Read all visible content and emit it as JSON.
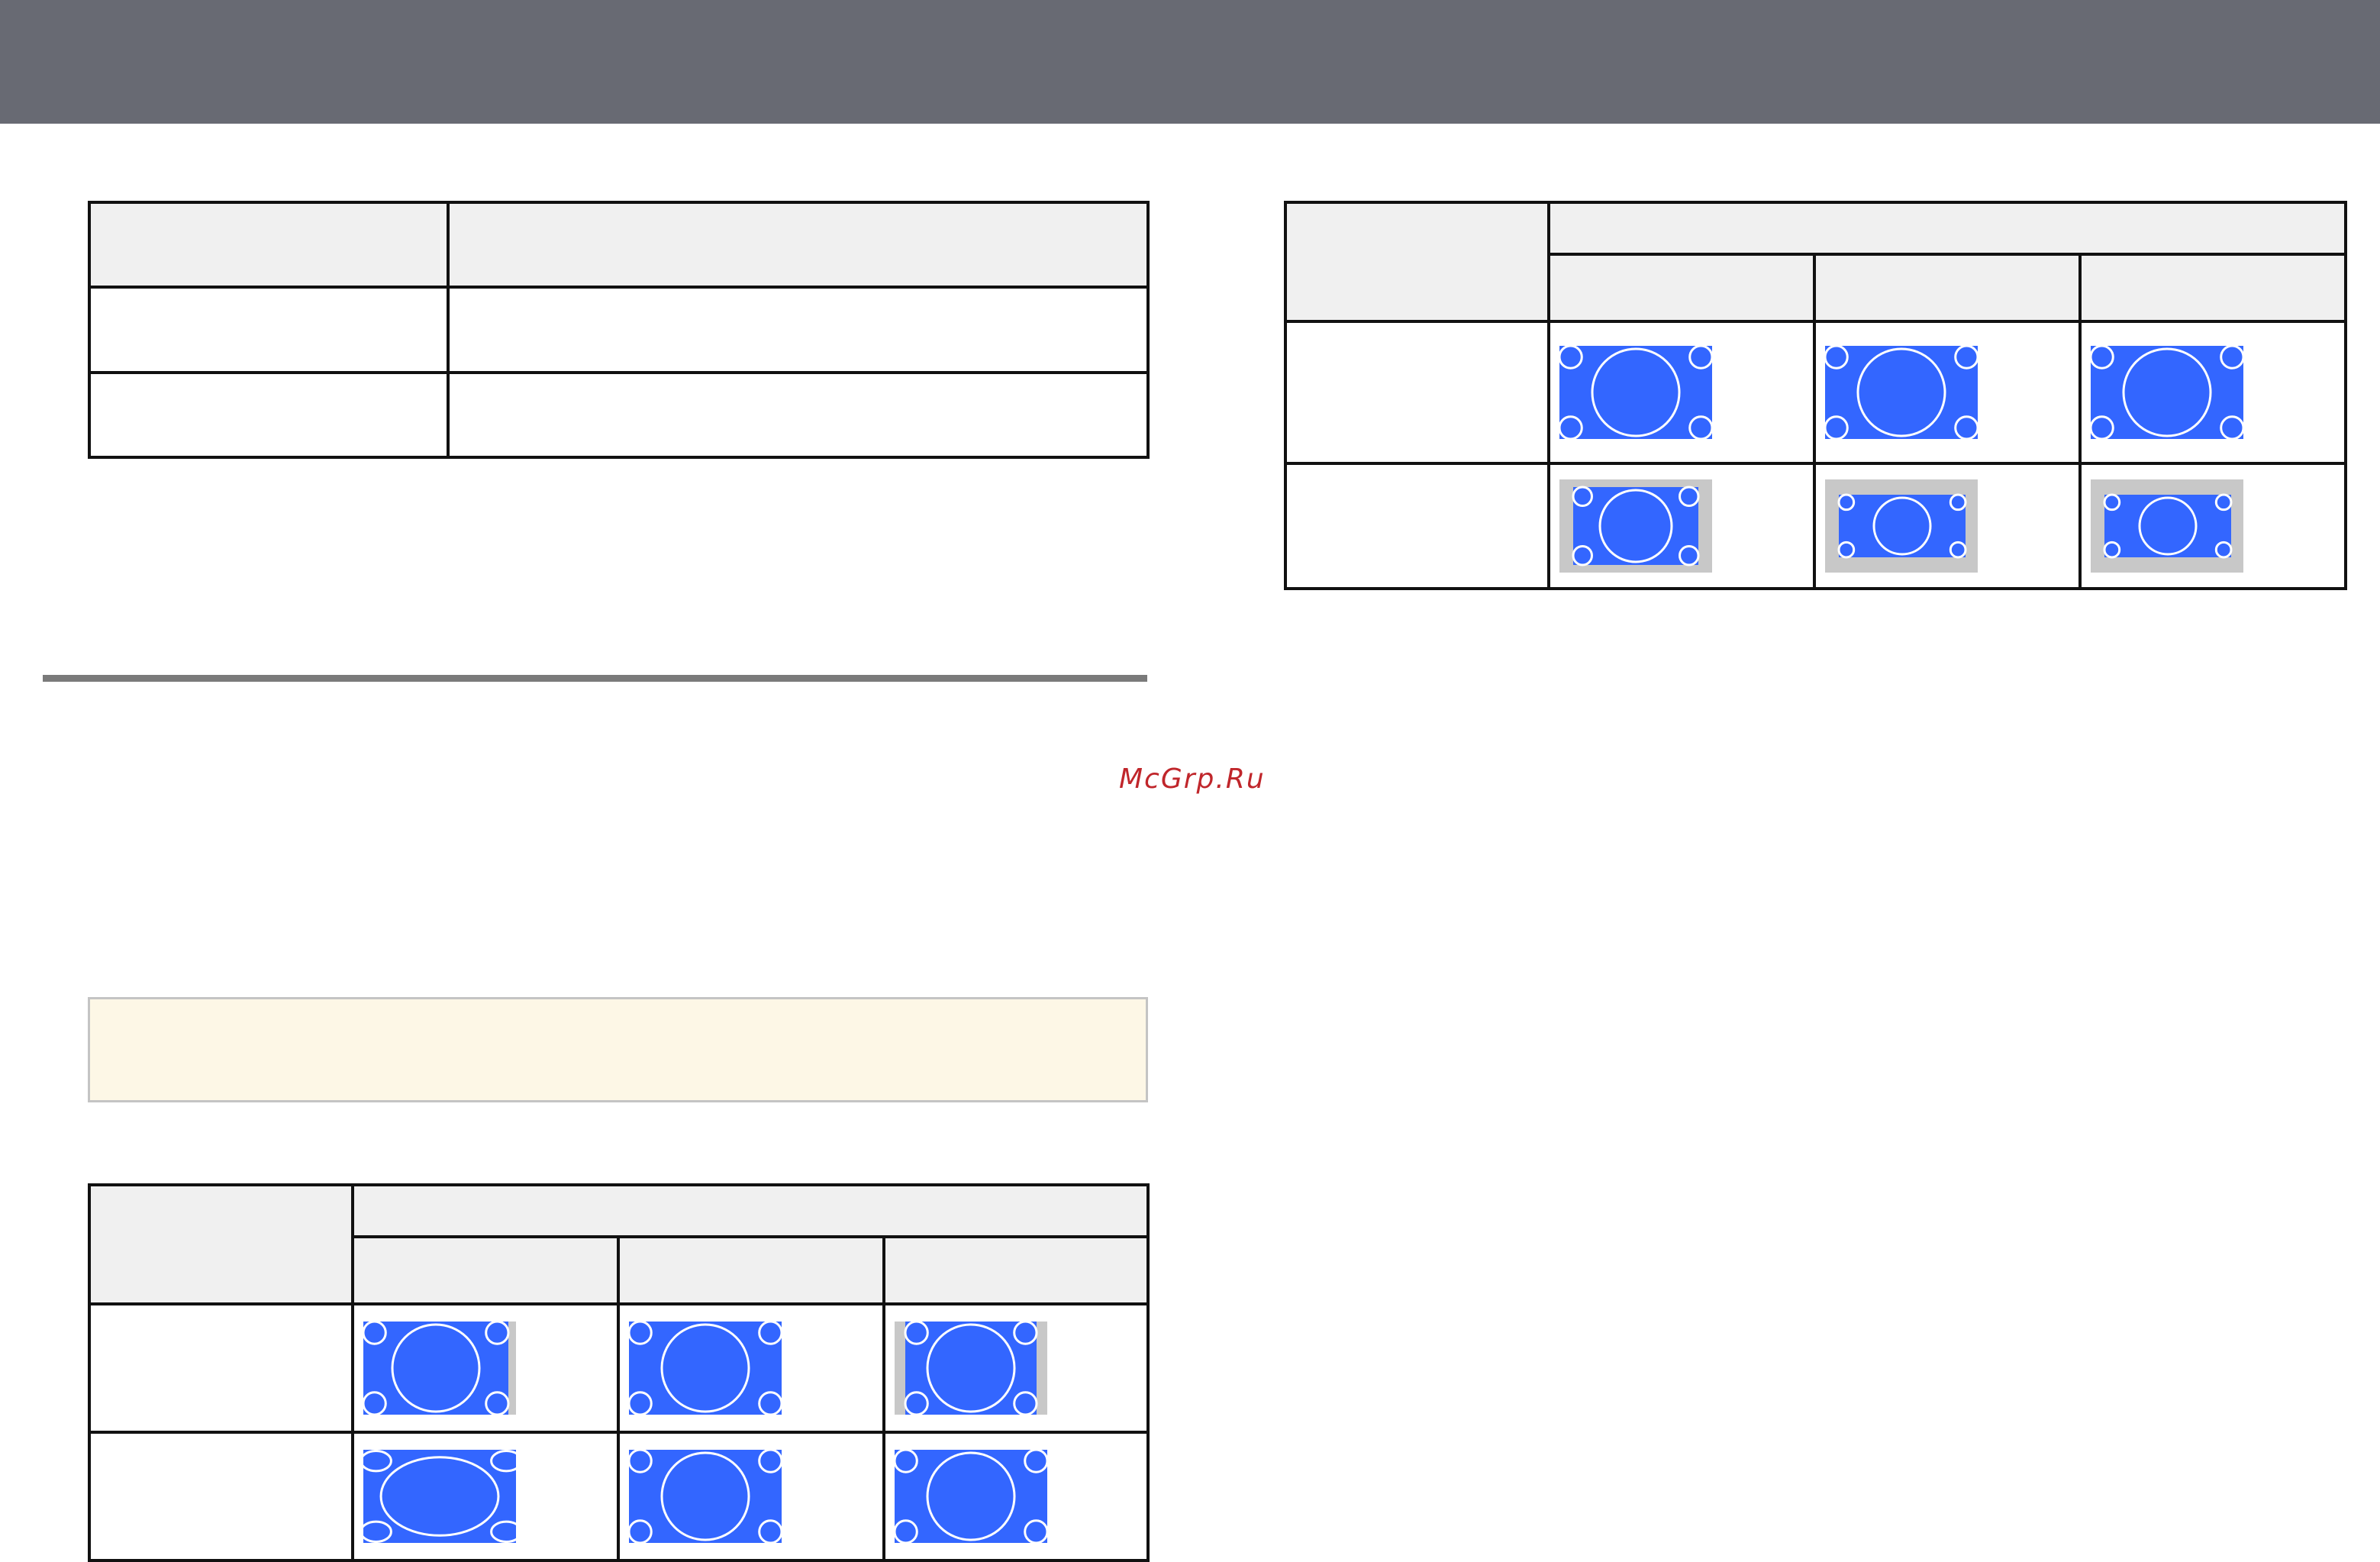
{
  "watermark": "McGrp.Ru",
  "colors": {
    "header": "#686a73",
    "table_header_fill": "#f0f0f0",
    "note_fill": "#fdf7e6",
    "screen_blue": "#3366ff",
    "letterbox_gray": "#c8c8c8",
    "watermark": "#c0262b"
  },
  "aspect_tables": {
    "upper_right": [
      [
        "full-screen",
        "full-screen",
        "full-screen"
      ],
      [
        "boxed",
        "boxed-small",
        "boxed-small"
      ]
    ],
    "lower_left": [
      [
        "pillarbox-right",
        "full-screen",
        "pillarbox"
      ],
      [
        "stretched",
        "full-screen",
        "full-screen"
      ]
    ]
  }
}
